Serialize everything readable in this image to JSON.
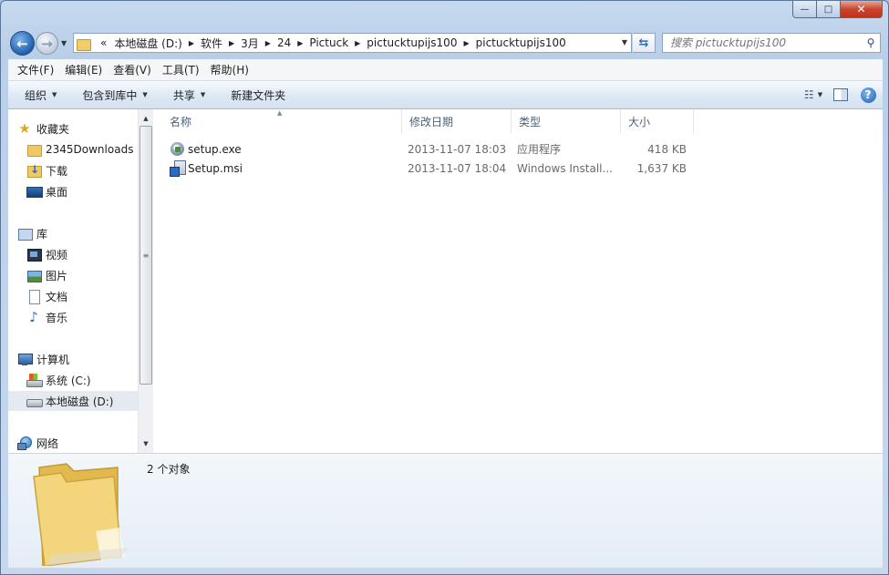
{
  "window": {
    "caption": {
      "minimize": "—",
      "maximize": "□",
      "close": "✕"
    }
  },
  "address_bar": {
    "overflow": "«",
    "crumbs": [
      "本地磁盘 (D:)",
      "软件",
      "3月",
      "24",
      "Pictuck",
      "pictucktupijs100",
      "pictucktupijs100"
    ]
  },
  "search": {
    "placeholder": "搜索 pictucktupijs100"
  },
  "menubar": {
    "items": [
      "文件(F)",
      "编辑(E)",
      "查看(V)",
      "工具(T)",
      "帮助(H)"
    ]
  },
  "commandbar": {
    "organize": "组织",
    "include_in_library": "包含到库中",
    "share": "共享",
    "new_folder": "新建文件夹"
  },
  "navpane": {
    "favorites": {
      "label": "收藏夹",
      "items": [
        "2345Downloads",
        "下载",
        "桌面"
      ]
    },
    "libraries": {
      "label": "库",
      "items": [
        "视频",
        "图片",
        "文档",
        "音乐"
      ]
    },
    "computer": {
      "label": "计算机",
      "items": [
        "系统 (C:)",
        "本地磁盘 (D:)"
      ],
      "selected": "本地磁盘 (D:)"
    },
    "network": {
      "label": "网络"
    }
  },
  "filelist": {
    "columns": [
      "名称",
      "修改日期",
      "类型",
      "大小"
    ],
    "rows": [
      {
        "name": "setup.exe",
        "modified": "2013-11-07 18:03",
        "type": "应用程序",
        "size": "418 KB",
        "icon": "exe-icon"
      },
      {
        "name": "Setup.msi",
        "modified": "2013-11-07 18:04",
        "type": "Windows Install...",
        "size": "1,637 KB",
        "icon": "msi-icon"
      }
    ]
  },
  "details": {
    "count": "2 个对象"
  },
  "colors": {
    "accent": "#2f6fb8",
    "folder": "#efc965",
    "selection": "#e5eaf1"
  }
}
